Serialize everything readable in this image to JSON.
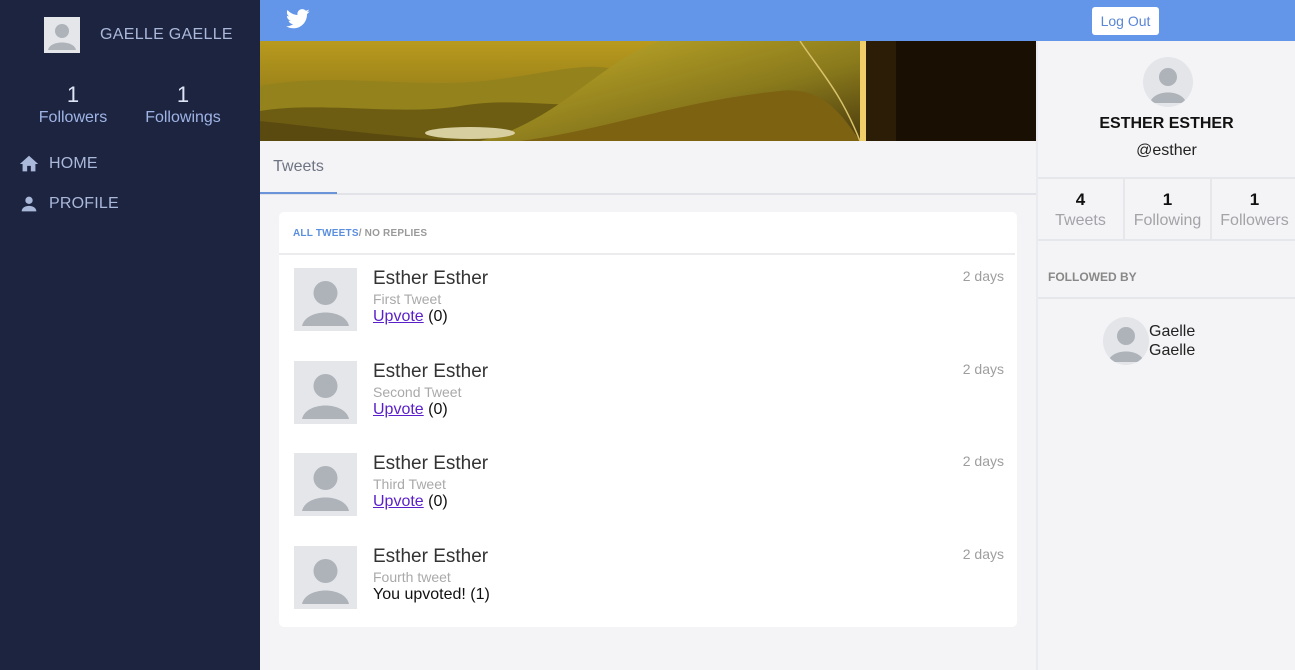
{
  "sidebar": {
    "user_name": "GAELLE GAELLE",
    "followers_count": "1",
    "followers_label": "Followers",
    "followings_count": "1",
    "followings_label": "Followings",
    "nav": [
      {
        "label": "HOME",
        "icon": "home-icon"
      },
      {
        "label": "PROFILE",
        "icon": "person-icon"
      }
    ]
  },
  "topbar": {
    "logo_icon": "twitter-bird-icon",
    "logout_label": "Log Out"
  },
  "tabs": {
    "active": "Tweets"
  },
  "feed": {
    "filter_active": "ALL TWEETS",
    "filter_separator": "/",
    "filter_other": " NO REPLIES",
    "tweets": [
      {
        "author": "Esther Esther",
        "text": "First Tweet",
        "vote_link": "Upvote",
        "vote_count": " (0)",
        "time": "2 days"
      },
      {
        "author": "Esther Esther",
        "text": "Second Tweet",
        "vote_link": "Upvote",
        "vote_count": " (0)",
        "time": "2 days"
      },
      {
        "author": "Esther Esther",
        "text": "Third Tweet",
        "vote_link": "Upvote",
        "vote_count": " (0)",
        "time": "2 days"
      },
      {
        "author": "Esther Esther",
        "text": "Fourth tweet",
        "voted_text": "You upvoted! (1)",
        "time": "2 days"
      }
    ]
  },
  "profile": {
    "name": "ESTHER ESTHER",
    "handle": "@esther",
    "stats": [
      {
        "num": "4",
        "label": "Tweets"
      },
      {
        "num": "1",
        "label": "Following"
      },
      {
        "num": "1",
        "label": "Followers"
      }
    ],
    "followed_by_label": "FOLLOWED BY",
    "followers": [
      {
        "first": "Gaelle",
        "last": "Gaelle"
      }
    ]
  },
  "colors": {
    "sidebar_bg": "#1c2440",
    "topbar_bg": "#6395e9",
    "accent": "#5b8fde",
    "upvote_link": "#5a1fc9"
  }
}
